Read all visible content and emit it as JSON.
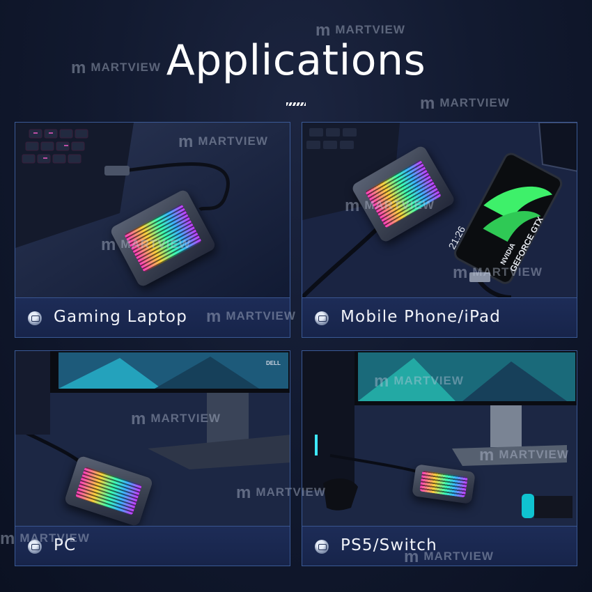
{
  "page": {
    "title": "Applications",
    "watermark": "MARTVIEW",
    "watermark_logo": "m"
  },
  "panels": [
    {
      "label": "Gaming Laptop",
      "icon": "usb-drive-icon"
    },
    {
      "label": "Mobile Phone/iPad",
      "icon": "usb-drive-icon"
    },
    {
      "label": "PC",
      "icon": "usb-drive-icon"
    },
    {
      "label": "PS5/Switch",
      "icon": "usb-drive-icon"
    }
  ],
  "screens": {
    "phone_clock": "21:26",
    "phone_brand": "NVIDIA",
    "phone_product": "GEFORCE GTX",
    "monitor_brand": "DELL"
  },
  "colors": {
    "background": "#121a30",
    "panel_border": "#3b5a96",
    "caption_bg": "#1d2c57",
    "rgb_accent": "#3cffb4"
  }
}
